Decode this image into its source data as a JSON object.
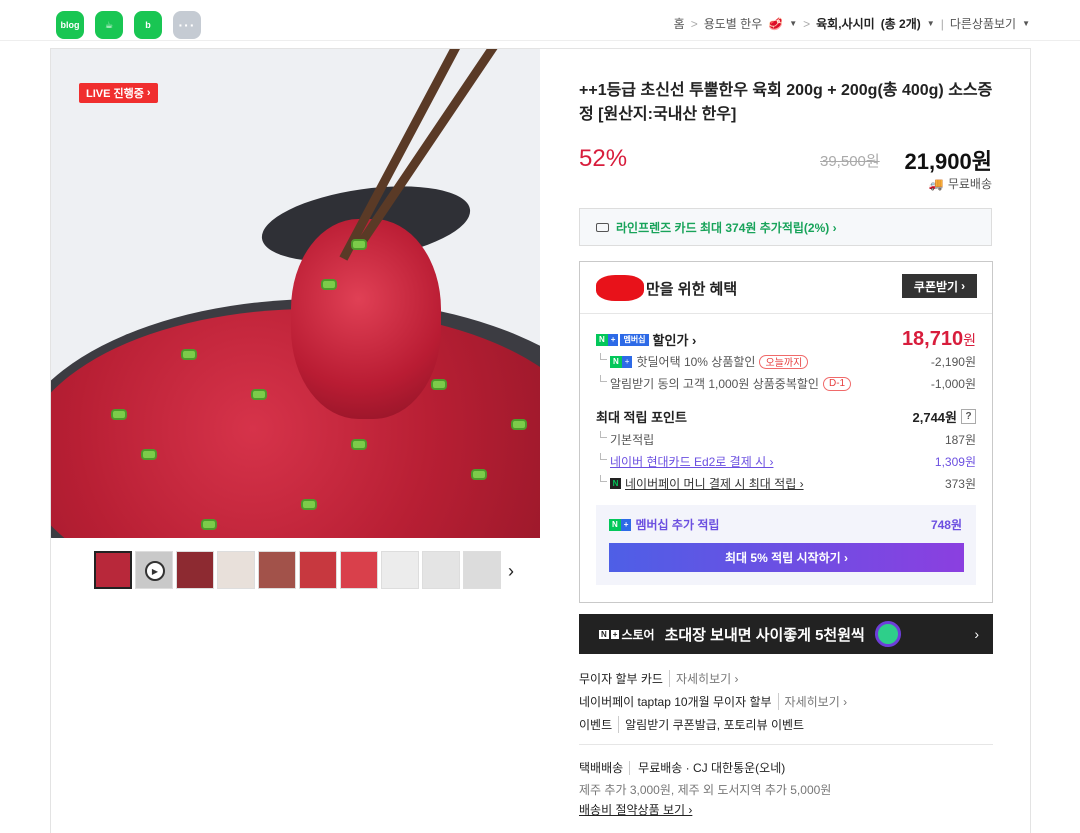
{
  "share": {
    "blog_label": "blog",
    "cafe_label": "☕",
    "band_label": "b",
    "more_label": "···"
  },
  "breadcrumb": {
    "home": "홈",
    "category": "용도별 한우",
    "category_emoji": "🥩",
    "current": "육회,사시미",
    "current_count": "(총 2개)",
    "other": "다른상품보기"
  },
  "media": {
    "live_label": "LIVE 진행중",
    "thumbnail_count": 10,
    "next_arrow": "›"
  },
  "product": {
    "title": "++1등급 초신선 투뿔한우 육회 200g + 200g(총 400g) 소스증정 [원산지:국내산 한우]",
    "discount_rate": "52%",
    "original_price": "39,500원",
    "sale_price": "21,900원",
    "shipping": "무료배송"
  },
  "card_promo": {
    "text": "라인프렌즈 카드 최대 374원 추가적립(2%) ›"
  },
  "benefit": {
    "header_suffix": "만을 위한 혜택",
    "coupon_button": "쿠폰받기",
    "membership_badge": "멤버십",
    "discount_price_label": "할인가 ›",
    "discount_price": "18,710",
    "won": "원",
    "items": [
      {
        "label": "핫딜어택 10% 상품할인",
        "tag": "오늘까지",
        "value": "-2,190원"
      },
      {
        "label": "알림받기 동의 고객 1,000원 상품중복할인",
        "tag": "D-1",
        "value": "-1,000원"
      }
    ],
    "points_label": "최대 적립 포인트",
    "points_value": "2,744원",
    "points_help": "?",
    "point_items": [
      {
        "label": "기본적립",
        "value": "187원"
      },
      {
        "label": "네이버 현대카드 Ed2로 결제 시 ›",
        "value": "1,309원"
      },
      {
        "label": "네이버페이 머니 결제 시 최대 적립 ›",
        "value": "373원"
      }
    ],
    "member_extra_label": "멤버십 추가 적립",
    "member_extra_value": "748원",
    "member_button": "최대 5% 적립 시작하기 ›"
  },
  "banner": {
    "logo_text": "스토어",
    "text": "초대장 보내면 사이좋게 5천원씩",
    "arrow": "›"
  },
  "payment": {
    "installment_label": "무이자 할부 카드",
    "installment_more": "자세히보기 ›",
    "taptap_label": "네이버페이 taptap 10개월 무이자 할부",
    "taptap_more": "자세히보기 ›",
    "event_label": "이벤트",
    "event_text": "알림받기 쿠폰발급, 포토리뷰 이벤트"
  },
  "delivery": {
    "label": "택배배송",
    "value": "무료배송 · CJ 대한통운(오네)",
    "extra": "제주 추가 3,000원, 제주 외 도서지역 추가 5,000원",
    "link": "배송비 절약상품 보기 ›"
  },
  "colors": {
    "naver_green": "#03c75a",
    "discount_red": "#d81d3c",
    "membership_purple": "#6b4fe0"
  }
}
